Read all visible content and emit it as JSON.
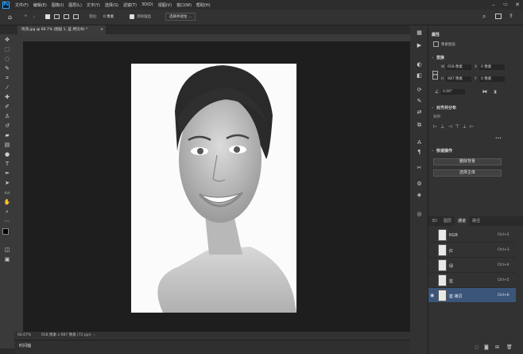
{
  "app": {
    "logo": "Ps"
  },
  "menu": [
    "文件(F)",
    "编辑(E)",
    "图像(I)",
    "图层(L)",
    "文字(Y)",
    "选择(S)",
    "滤镜(T)",
    "3D(D)",
    "视图(V)",
    "窗口(W)",
    "帮助(H)"
  ],
  "options": {
    "feather_label": "羽化:",
    "feather_value": "0 像素",
    "antialias_label": "消除锯齿",
    "select_mask": "选择并遮住 ..."
  },
  "document": {
    "tab_title": "鸡汤.jpg @ 66.7% (图层 1, 蓝 拷贝/8) *",
    "close": "×"
  },
  "status": {
    "zoom": "66.67%",
    "size": "658 像素 x 987 像素 (72 ppi)"
  },
  "timeline": {
    "label": "时间轴"
  },
  "properties": {
    "title": "属性",
    "layer_type": "像素图层",
    "transform_title": "变换",
    "w_label": "W",
    "w_value": "658 像素",
    "h_label": "H",
    "h_value": "987 像素",
    "x_label": "X",
    "x_value": "0 像素",
    "y_label": "Y",
    "y_value": "0 像素",
    "angle_value": "0.00°",
    "align_title": "对齐并分布",
    "align_label": "对齐:",
    "more": "•••",
    "quick_title": "快速操作",
    "remove_bg": "删除背景",
    "select_subject": "选择主体"
  },
  "panel_tabs": [
    "3D",
    "图层",
    "通道",
    "路径"
  ],
  "channels": [
    {
      "name": "RGB",
      "shortcut": "Ctrl+2"
    },
    {
      "name": "红",
      "shortcut": "Ctrl+3"
    },
    {
      "name": "绿",
      "shortcut": "Ctrl+4"
    },
    {
      "name": "蓝",
      "shortcut": "Ctrl+5"
    },
    {
      "name": "蓝 拷贝",
      "shortcut": "Ctrl+6"
    }
  ]
}
